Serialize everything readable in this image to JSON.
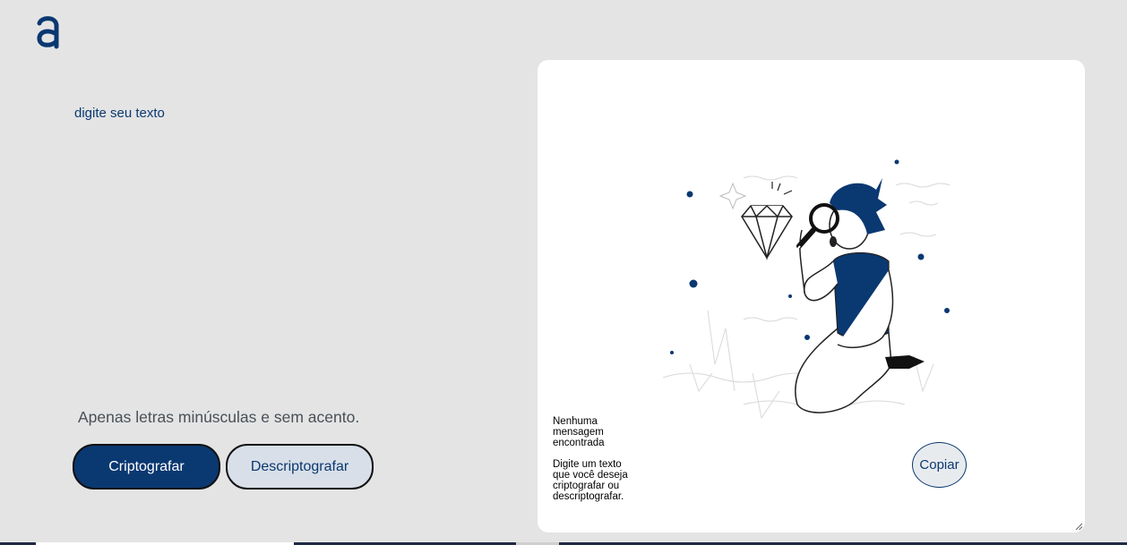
{
  "header": {
    "logo_icon": "alura-a-logo-icon"
  },
  "input": {
    "placeholder": "digite seu texto",
    "value": ""
  },
  "hint": {
    "text": "Apenas letras minúsculas e sem acento."
  },
  "actions": {
    "encrypt_label": "Criptografar",
    "decrypt_label": "Descriptografar"
  },
  "output": {
    "illustration_icon": "person-with-magnifying-glass-illustration",
    "empty_title": "Nenhuma mensagem encontrada",
    "empty_description": "Digite um texto que você deseja criptografar ou descriptografar.",
    "copy_label": "Copiar"
  },
  "colors": {
    "background": "#e4e4e4",
    "primary": "#0a3871",
    "panel": "#ffffff",
    "secondary_button": "#d8dfe8"
  }
}
